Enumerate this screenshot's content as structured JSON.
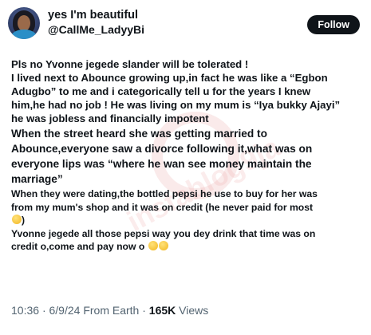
{
  "header": {
    "display_name": "yes I'm beautiful",
    "handle": "@CallMe_LadyyBi",
    "follow_label": "Follow"
  },
  "tweet": {
    "p1": [
      "Pls no Yvonne jegede slander will be tolerated !",
      "I lived next to Abounce growing up,in fact he was like a “Egbon",
      "Adugbo” to me and i categorically tell u for the years I knew",
      "him,he had no job ! He was living on my mum is “Iya bukky Ajayi”",
      "he was jobless and financially impotent"
    ],
    "p2": [
      "When the street heard she was getting married to",
      "Abounce,everyone saw a divorce following it,what was on",
      "everyone lips was “where he wan see money maintain the",
      "marriage”"
    ],
    "p3": [
      "When they were dating,the bottled pepsi he use to buy for her was",
      "from my mum's shop and it was on credit (he never paid for most"
    ],
    "p3_end": ")",
    "p4": [
      "Yvonne jegede all those pepsi way you dey drink that time  was on",
      "credit o,come and pay now o"
    ]
  },
  "meta": {
    "time": "10:36",
    "separator": "·",
    "date": "6/9/24",
    "source": "From Earth",
    "views_count": "165K",
    "views_label": "Views"
  },
  "watermark": {
    "text": "instablog9ja"
  }
}
